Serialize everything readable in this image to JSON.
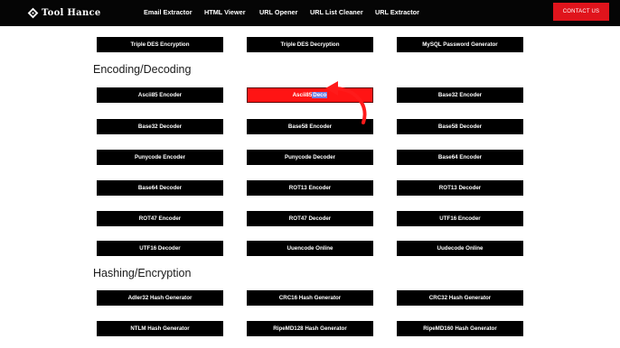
{
  "header": {
    "logo_text": "Tool Hance",
    "nav": [
      "Email Extractor",
      "HTML Viewer",
      "URL Opener",
      "URL List Cleaner",
      "URL Extractor"
    ],
    "contact_label": "CONTACT US"
  },
  "top_row": [
    "Triple DES Encryption",
    "Triple DES Decryption",
    "MySQL Password Generator"
  ],
  "sections": [
    {
      "title": "Encoding/Decoding",
      "tools": [
        "Ascii85 Encoder",
        "Ascii85 Decoder",
        "Base32 Encoder",
        "Base32 Decoder",
        "Base58 Encoder",
        "Base58 Decoder",
        "Punycode Encoder",
        "Punycode Decoder",
        "Base64 Encoder",
        "Base64 Decoder",
        "ROT13 Encoder",
        "ROT13 Decoder",
        "ROT47 Encoder",
        "ROT47 Decoder",
        "UTF16 Encoder",
        "UTF16 Decoder",
        "Uuencode Online",
        "Uudecode Online"
      ]
    },
    {
      "title": "Hashing/Encryption",
      "tools": [
        "Adler32 Hash Generator",
        "CRC16 Hash Generator",
        "CRC32 Hash Generator",
        "NTLM Hash Generator",
        "RipeMD128 Hash Generator",
        "RipeMD160 Hash Generator"
      ]
    }
  ],
  "highlighted_tool": {
    "visible_text_plain": "Ascii85 ",
    "visible_text_selected": "Deco"
  },
  "colors": {
    "header_bg": "#050505",
    "accent": "#e0141c",
    "button_bg": "#000000",
    "selection": "#6f7fe0"
  },
  "icons": {
    "logo": "tool-hance-logo-icon",
    "annotation": "curved-arrow-icon"
  }
}
